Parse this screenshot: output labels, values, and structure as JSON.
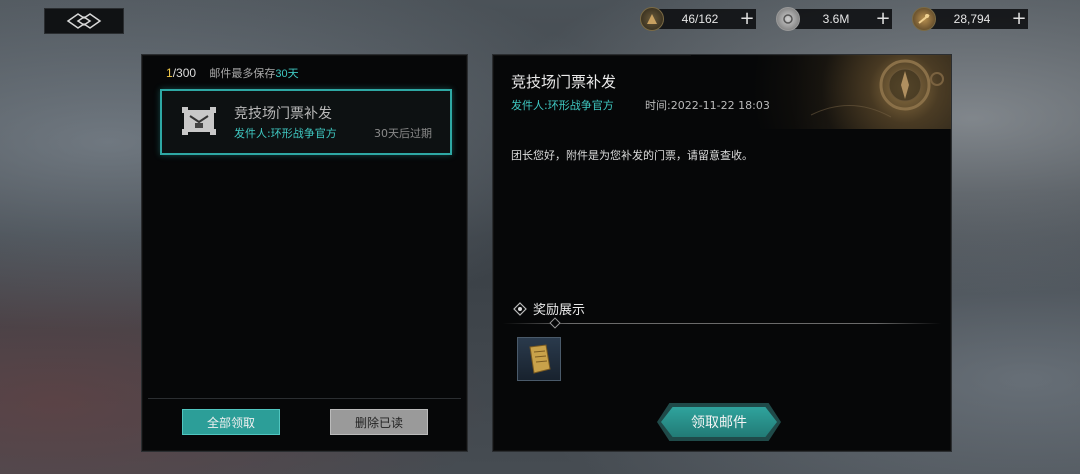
{
  "currencies": [
    {
      "icon": "stamina-icon",
      "value": "46/162"
    },
    {
      "icon": "silver-coin-icon",
      "value": "3.6M"
    },
    {
      "icon": "gold-resource-icon",
      "value": "28,794"
    }
  ],
  "mail_list": {
    "count_current": "1",
    "count_total": "/300",
    "note_prefix": "邮件最多保存",
    "note_highlight": "30天",
    "items": [
      {
        "title": "竞技场门票补发",
        "sender": "发件人:环形战争官方",
        "expire": "30天后过期"
      }
    ],
    "claim_all_label": "全部领取",
    "delete_read_label": "删除已读"
  },
  "mail_detail": {
    "title": "竞技场门票补发",
    "sender": "发件人:环形战争官方",
    "time": "时间:2022-11-22 18:03",
    "body": "团长您好，附件是为您补发的门票，请留意查收。",
    "reward_heading": "奖励展示",
    "rewards": [
      {
        "icon": "ticket-scroll-icon"
      }
    ],
    "claim_label": "领取邮件"
  },
  "colors": {
    "accent": "#2ea8a4",
    "highlight_text": "#3fc8c2",
    "count_gold": "#f0c84a"
  }
}
